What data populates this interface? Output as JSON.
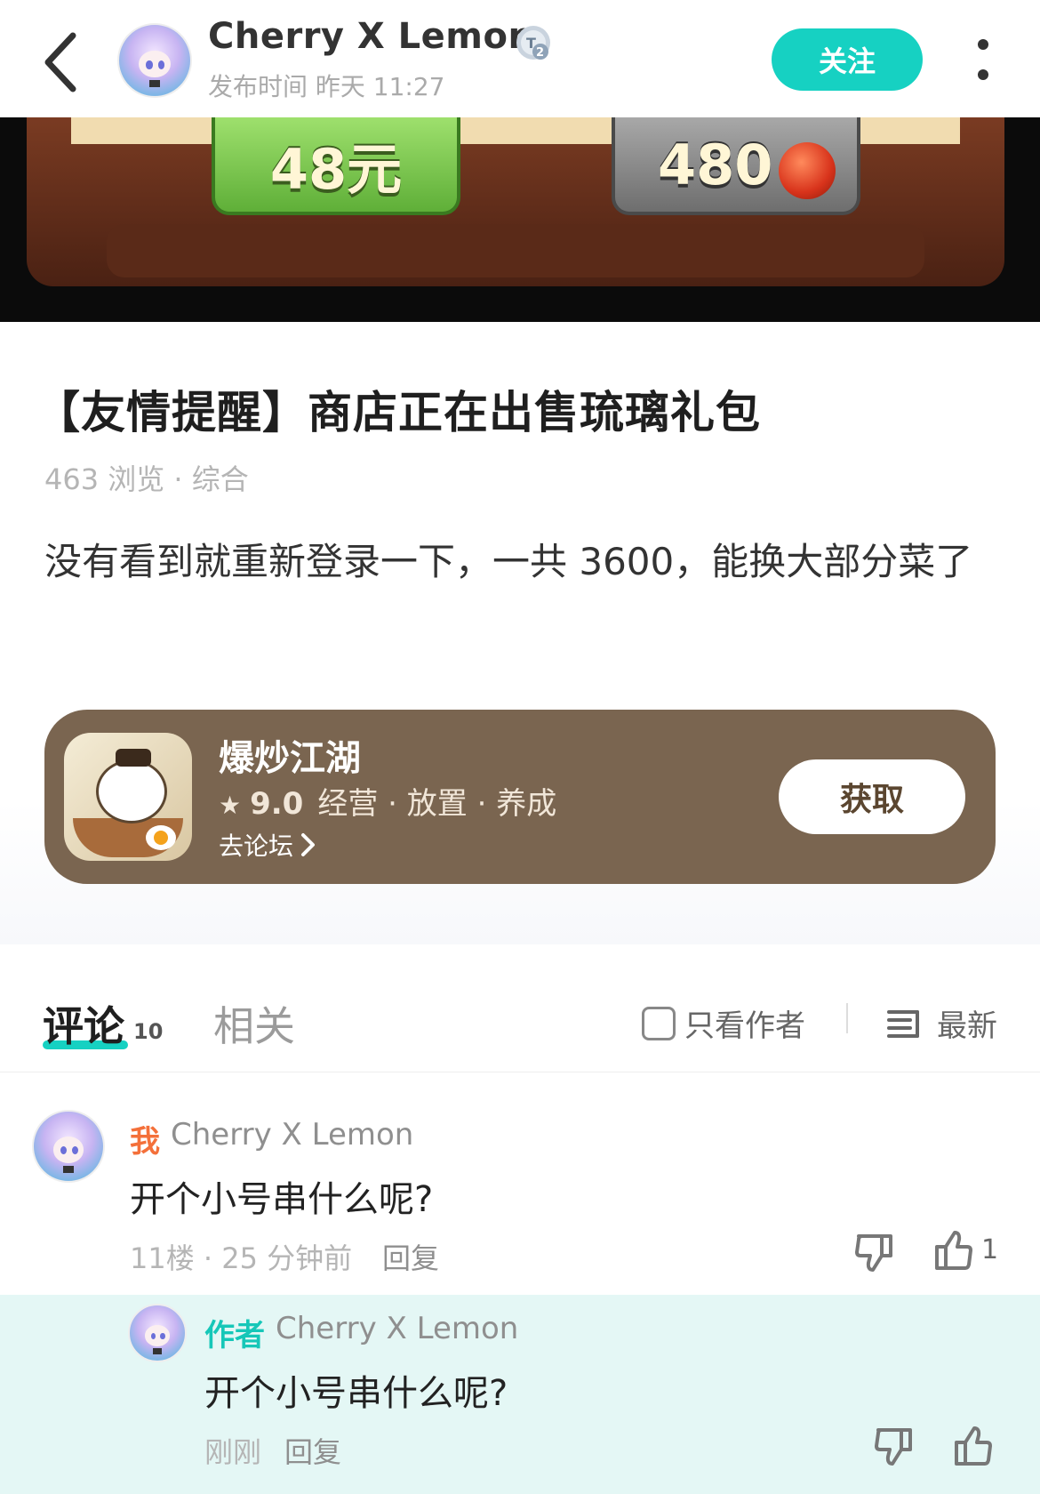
{
  "header": {
    "author_name": "Cherry X Lemon",
    "level_badge": "T2",
    "post_time": "发布时间 昨天 11:27",
    "follow_label": "关注"
  },
  "banner": {
    "price_left": "48元",
    "price_right": "480"
  },
  "post": {
    "title": "【友情提醒】商店正在出售琉璃礼包",
    "meta": "463 浏览 · 综合",
    "body": "没有看到就重新登录一下，一共 3600，能换大部分菜了"
  },
  "game_card": {
    "name": "爆炒江湖",
    "star": "★",
    "rating": "9.0",
    "tags": "经营 · 放置 · 养成",
    "forum_link": "去论坛",
    "get_label": "获取",
    "bg_color": "#7a6550"
  },
  "tabs": {
    "comments_label": "评论",
    "comments_count": "10",
    "related_label": "相关",
    "only_author_label": "只看作者",
    "sort_label": "最新",
    "accent_color": "#16d1c2"
  },
  "comments": [
    {
      "tag": "我",
      "name": "Cherry X Lemon",
      "text": "开个小号串什么呢?",
      "meta": "11楼 · 25 分钟前",
      "reply_label": "回复",
      "like_count": "1",
      "reply": {
        "tag": "作者",
        "name": "Cherry X Lemon",
        "text": "开个小号串什么呢?",
        "time": "刚刚",
        "reply_label": "回复"
      }
    }
  ],
  "icons": {
    "back": "chevron-left-icon",
    "more": "more-vertical-icon",
    "sort": "sort-list-icon",
    "like": "thumbs-up-icon",
    "dislike": "thumbs-down-icon"
  }
}
